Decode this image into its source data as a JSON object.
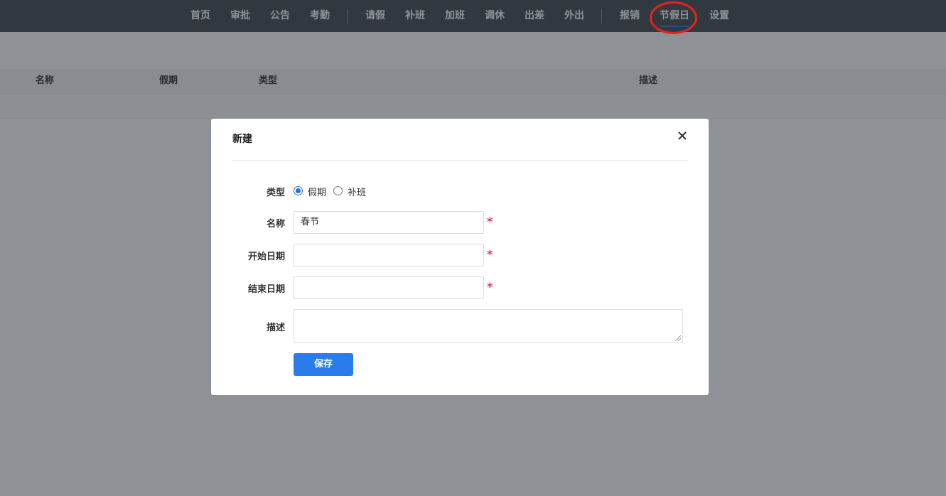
{
  "nav": {
    "items": [
      {
        "label": "首页"
      },
      {
        "label": "审批"
      },
      {
        "label": "公告"
      },
      {
        "label": "考勤"
      },
      {
        "label": "请假"
      },
      {
        "label": "补班"
      },
      {
        "label": "加班"
      },
      {
        "label": "调休"
      },
      {
        "label": "出差"
      },
      {
        "label": "外出"
      },
      {
        "label": "报销"
      },
      {
        "label": "节假日"
      },
      {
        "label": "设置"
      }
    ],
    "active": "节假日"
  },
  "table": {
    "columns": [
      "名称",
      "假期",
      "类型",
      "描述"
    ]
  },
  "modal": {
    "title": "新建",
    "close_icon": "close-icon",
    "type_label": "类型",
    "type_options": [
      "假期",
      "补班"
    ],
    "type_selected": "假期",
    "name_label": "名称",
    "name_value": "春节",
    "start_label": "开始日期",
    "start_value": "",
    "end_label": "结束日期",
    "end_value": "",
    "desc_label": "描述",
    "desc_value": "",
    "required_mark": "*",
    "save_label": "保存"
  },
  "colors": {
    "nav_bg": "#454c55",
    "accent": "#2a7cea",
    "required": "#e5395b",
    "highlight": "#e8231b"
  }
}
